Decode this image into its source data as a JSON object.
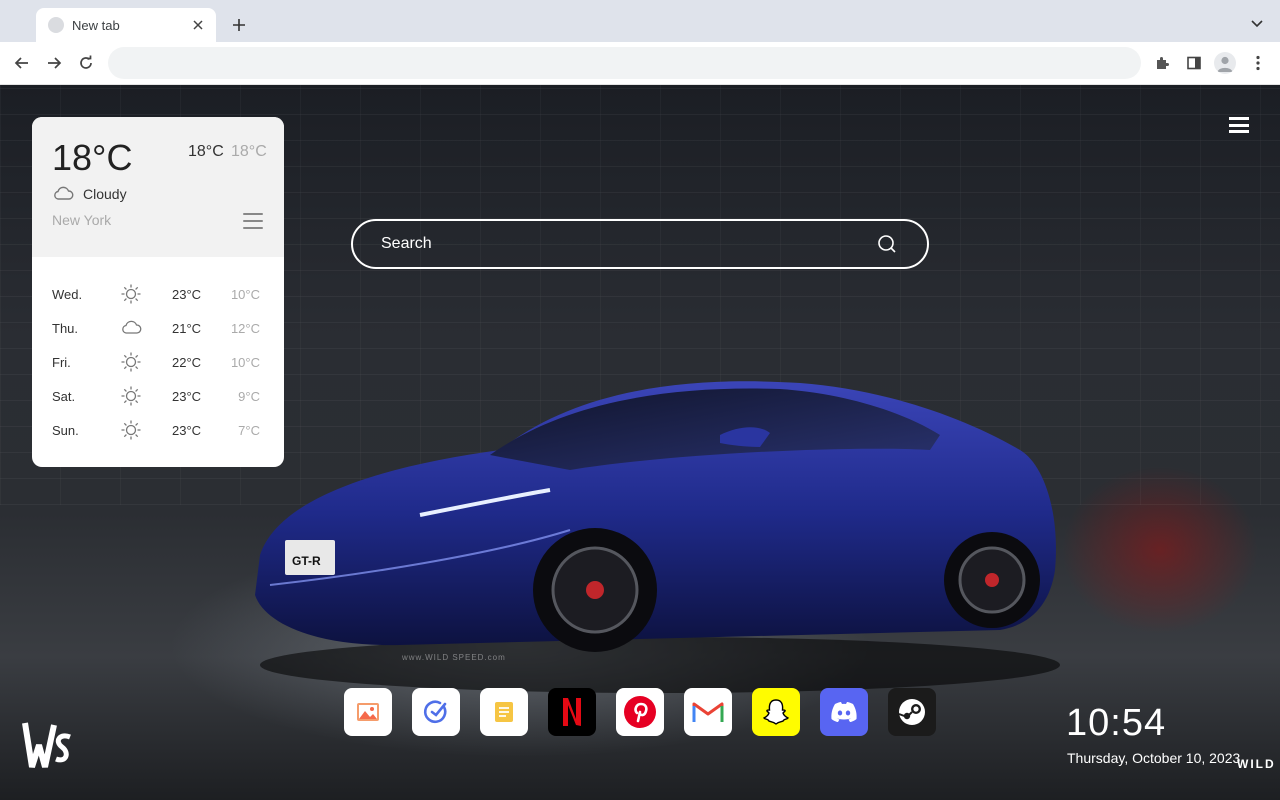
{
  "browser": {
    "tab_title": "New tab",
    "omnibox_value": ""
  },
  "weather": {
    "temp": "18°C",
    "high": "18°C",
    "low": "18°C",
    "condition": "Cloudy",
    "city": "New York",
    "forecast": [
      {
        "day": "Wed.",
        "icon": "sun-icon",
        "high": "23°C",
        "low": "10°C"
      },
      {
        "day": "Thu.",
        "icon": "cloud-icon",
        "high": "21°C",
        "low": "12°C"
      },
      {
        "day": "Fri.",
        "icon": "sun-icon",
        "high": "22°C",
        "low": "10°C"
      },
      {
        "day": "Sat.",
        "icon": "sun-icon",
        "high": "23°C",
        "low": "9°C"
      },
      {
        "day": "Sun.",
        "icon": "sun-icon",
        "high": "23°C",
        "low": "7°C"
      }
    ]
  },
  "search": {
    "placeholder": "Search"
  },
  "shortcuts": [
    {
      "name": "gallery",
      "icon": "photo-icon",
      "color": "#ffffff"
    },
    {
      "name": "tasks",
      "icon": "check-circle-icon",
      "color": "#ffffff"
    },
    {
      "name": "notes",
      "icon": "notes-icon",
      "color": "#ffffff"
    },
    {
      "name": "netflix",
      "icon": "netflix-icon",
      "color": "#000000"
    },
    {
      "name": "pinterest",
      "icon": "pinterest-icon",
      "color": "#ffffff"
    },
    {
      "name": "gmail",
      "icon": "gmail-icon",
      "color": "#ffffff"
    },
    {
      "name": "snapchat",
      "icon": "snapchat-icon",
      "color": "#fffc00"
    },
    {
      "name": "discord",
      "icon": "discord-icon",
      "color": "#5865f2"
    },
    {
      "name": "steam",
      "icon": "steam-icon",
      "color": "#1b1b1b"
    }
  ],
  "clock": {
    "time": "10:54",
    "date": "Thursday, October 10, 2023"
  },
  "branding": {
    "corner_text": "WILD",
    "watermark": "www.WILD SPEED.com",
    "plate": "GT-R"
  }
}
